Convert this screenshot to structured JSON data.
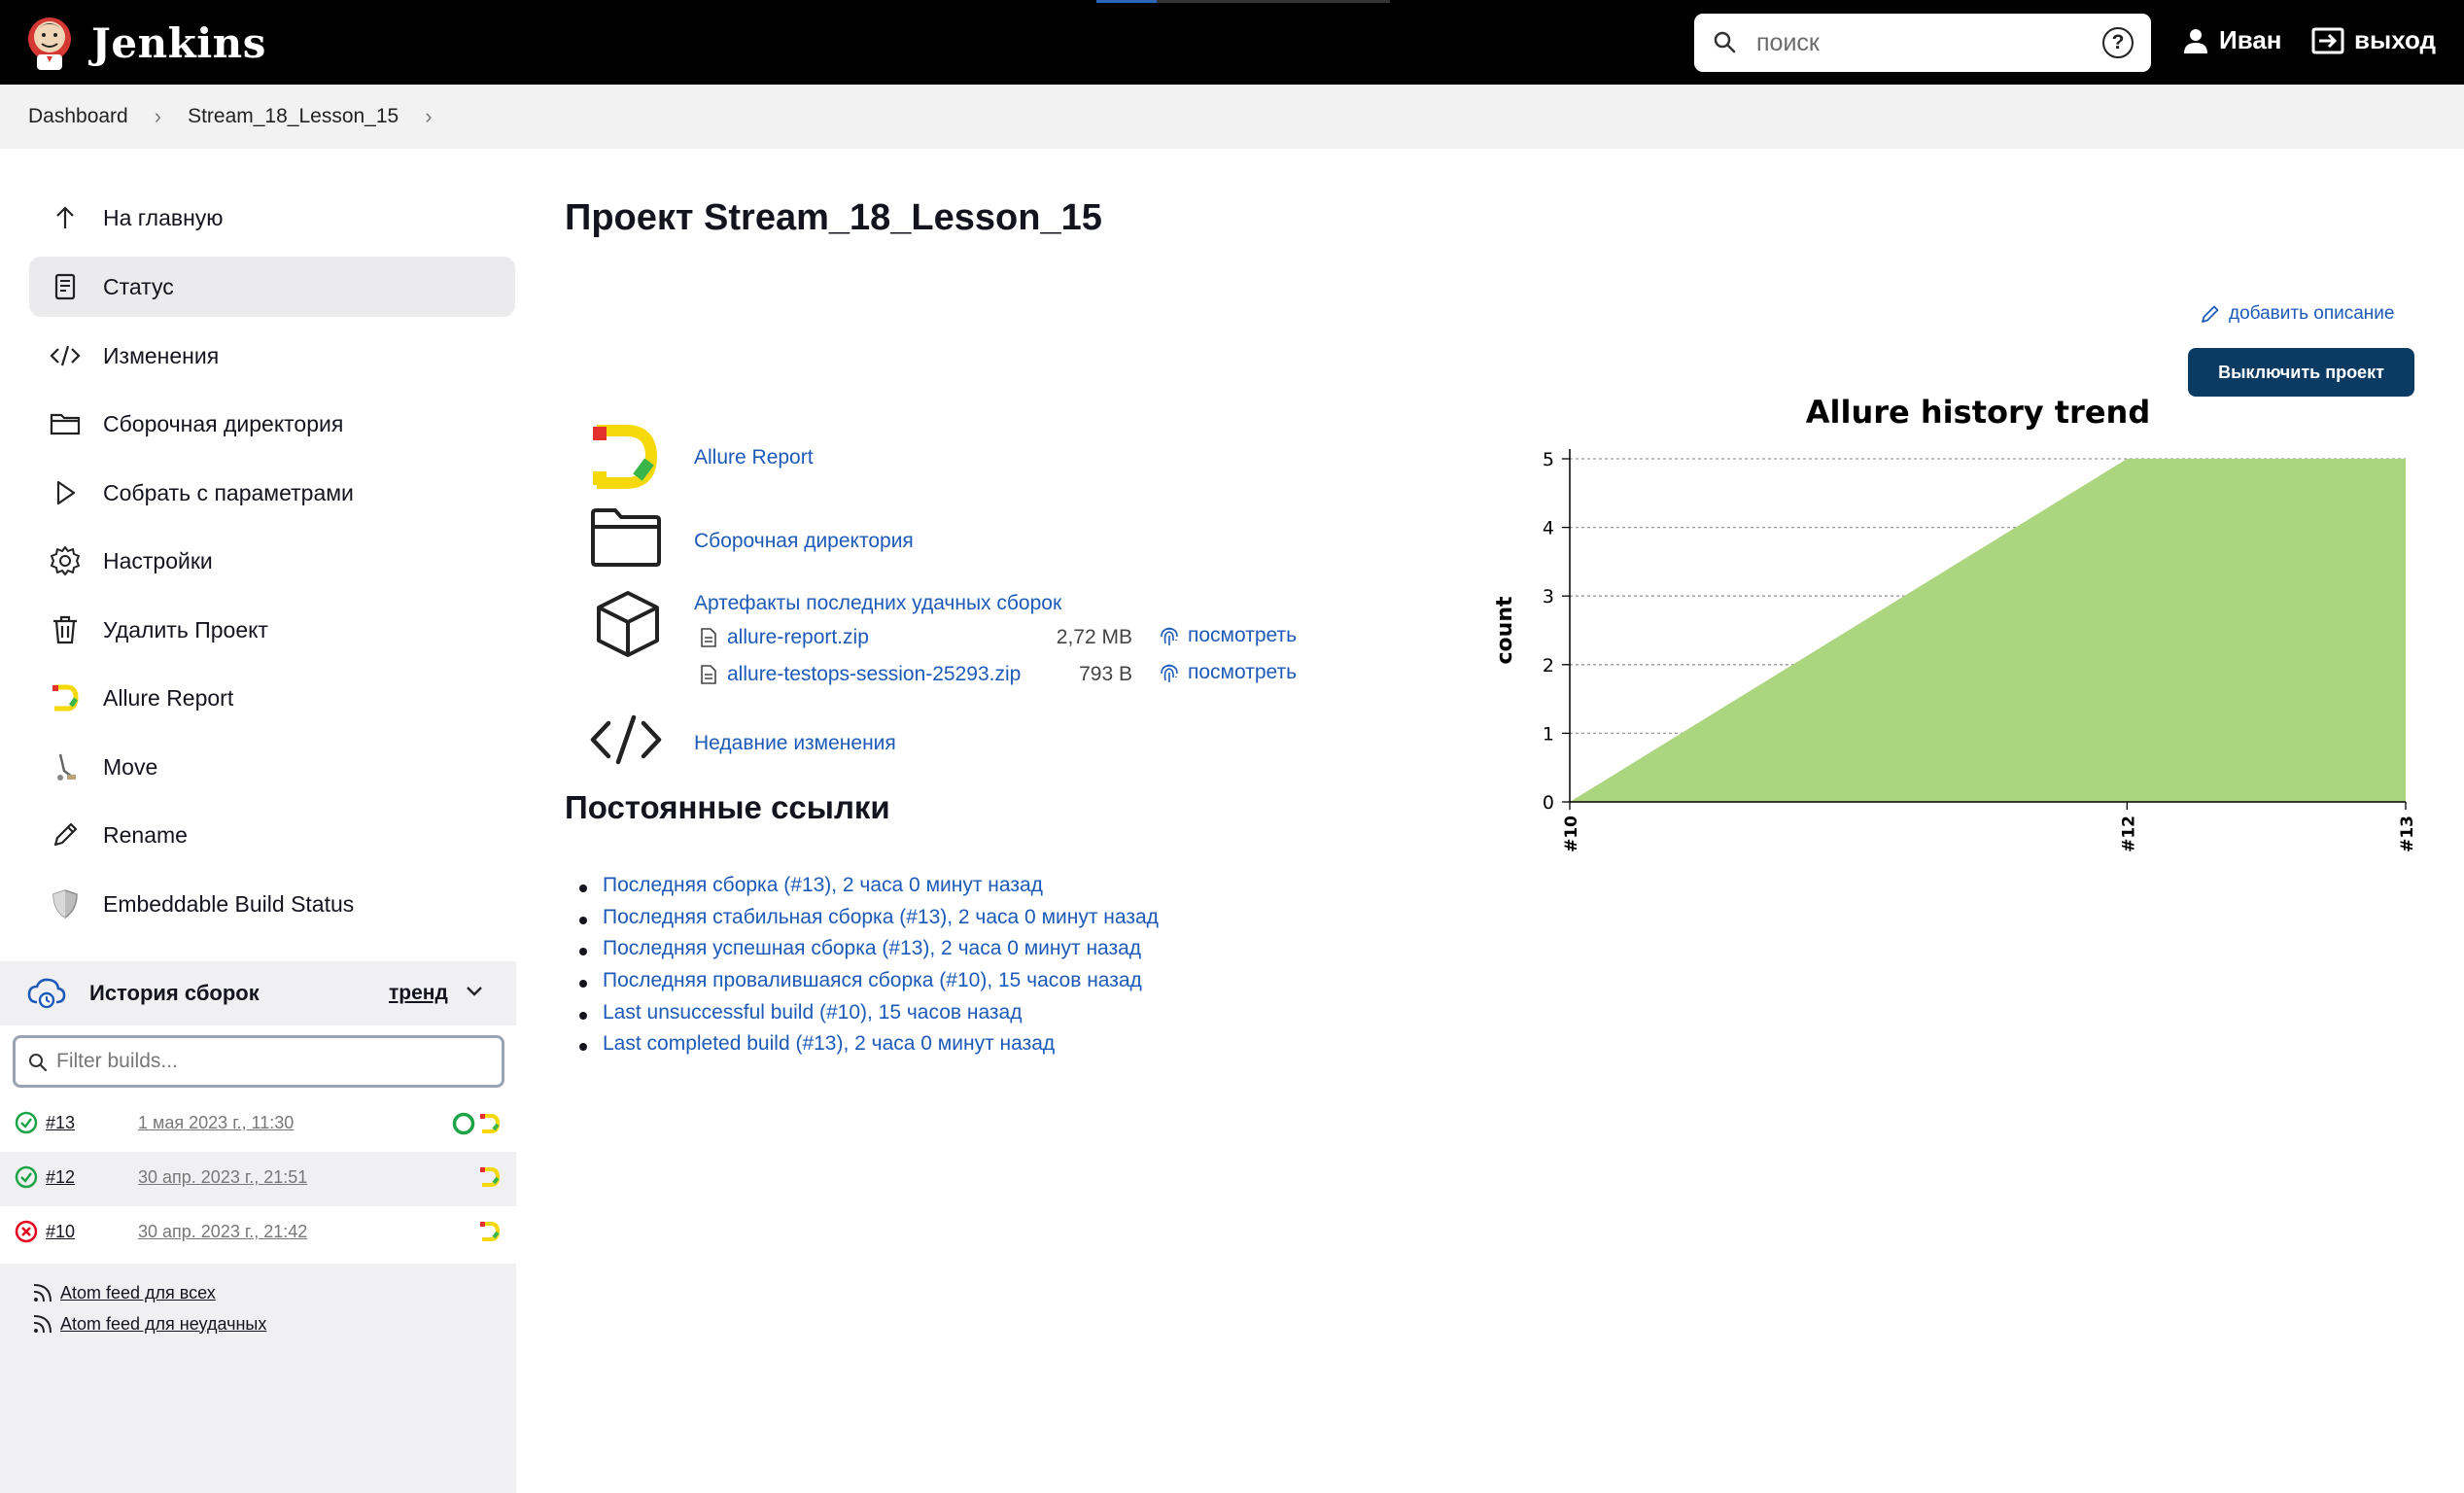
{
  "header": {
    "app_name": "Jenkins",
    "search_placeholder": "поиск",
    "help": "?",
    "user_name": "Иван",
    "logout_label": "выход"
  },
  "breadcrumb": [
    "Dashboard",
    "Stream_18_Lesson_15"
  ],
  "sidebar": {
    "items": [
      {
        "label": "На главную",
        "icon": "arrow-up-icon"
      },
      {
        "label": "Статус",
        "icon": "document-icon",
        "active": true
      },
      {
        "label": "Изменения",
        "icon": "code-icon"
      },
      {
        "label": "Сборочная директория",
        "icon": "folder-icon"
      },
      {
        "label": "Собрать с параметрами",
        "icon": "play-icon"
      },
      {
        "label": "Настройки",
        "icon": "gear-icon"
      },
      {
        "label": "Удалить Проект",
        "icon": "trash-icon"
      },
      {
        "label": "Allure Report",
        "icon": "allure-icon"
      },
      {
        "label": "Move",
        "icon": "move-icon"
      },
      {
        "label": "Rename",
        "icon": "pencil-icon"
      },
      {
        "label": "Embeddable Build Status",
        "icon": "shield-icon"
      }
    ],
    "build_history": {
      "title": "История сборок",
      "trend_label": "тренд",
      "filter_placeholder": "Filter builds...",
      "builds": [
        {
          "number": "#13",
          "date": "1 мая 2023 г., 11:30",
          "status": "success"
        },
        {
          "number": "#12",
          "date": "30 апр. 2023 г., 21:51",
          "status": "success"
        },
        {
          "number": "#10",
          "date": "30 апр. 2023 г., 21:42",
          "status": "failed"
        }
      ],
      "feeds": [
        "Atom feed для всех",
        "Atom feed для неудачных"
      ]
    }
  },
  "main": {
    "title": "Проект Stream_18_Lesson_15",
    "add_description": "добавить описание",
    "disable_button": "Выключить проект",
    "links": {
      "allure": "Allure Report",
      "workspace": "Сборочная директория",
      "artifacts_title": "Артефакты последних удачных сборок",
      "artifacts": [
        {
          "name": "allure-report.zip",
          "size": "2,72 MB",
          "view": "посмотреть"
        },
        {
          "name": "allure-testops-session-25293.zip",
          "size": "793 B",
          "view": "посмотреть"
        }
      ],
      "changes": "Недавние изменения"
    },
    "permalinks_title": "Постоянные ссылки",
    "permalinks": [
      "Последняя сборка (#13), 2 часа 0 минут назад",
      "Последняя стабильная сборка (#13), 2 часа 0 минут назад",
      "Последняя успешная сборка (#13), 2 часа 0 минут назад",
      "Последняя провалившаяся сборка (#10), 15 часов назад",
      "Last unsuccessful build (#10), 15 часов назад",
      "Last completed build (#13), 2 часа 0 минут назад"
    ]
  },
  "colors": {
    "header_bg": "#000000",
    "link": "#1d5ab8",
    "button_bg": "#0b3a63",
    "chart_fill": "#acd57f",
    "success": "#1ea446",
    "failed": "#e6001f"
  },
  "chart_data": {
    "type": "area",
    "title": "Allure history trend",
    "ylabel": "count",
    "xlabel": "",
    "categories": [
      "#10",
      "#12",
      "#13"
    ],
    "series": [
      {
        "values": [
          0,
          5,
          5
        ]
      }
    ],
    "ylim": [
      0,
      5
    ],
    "yticks": [
      0,
      1,
      2,
      3,
      4,
      5
    ],
    "grid": true
  }
}
